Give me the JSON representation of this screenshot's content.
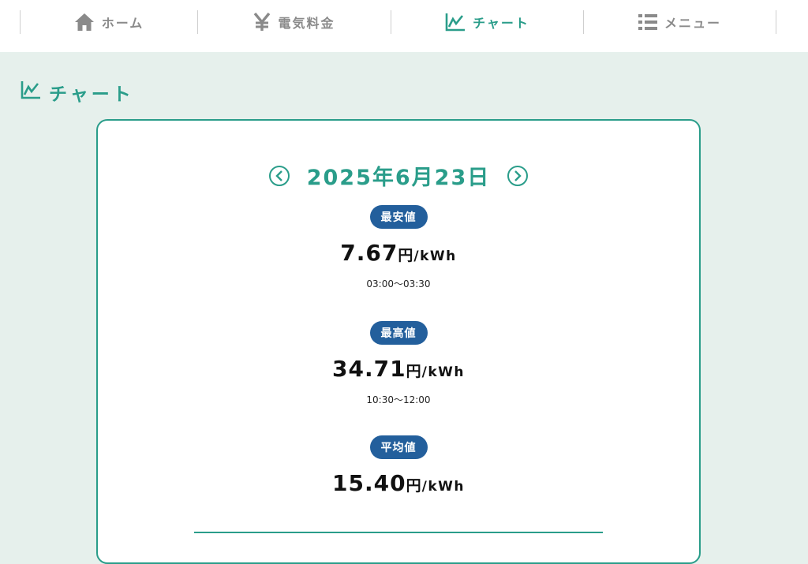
{
  "nav": {
    "items": [
      {
        "label": "ホーム",
        "icon": "home-icon"
      },
      {
        "label": "電気料金",
        "icon": "yen-icon"
      },
      {
        "label": "チャート",
        "icon": "chart-icon",
        "active": true
      },
      {
        "label": "メニュー",
        "icon": "list-icon"
      }
    ]
  },
  "page": {
    "title": "チャート"
  },
  "card": {
    "date": "2025年6月23日",
    "stats": [
      {
        "badge": "最安値",
        "value": "7.67",
        "unit": "円",
        "per": "/kWh",
        "time": "03:00〜03:30"
      },
      {
        "badge": "最高値",
        "value": "34.71",
        "unit": "円",
        "per": "/kWh",
        "time": "10:30〜12:00"
      },
      {
        "badge": "平均値",
        "value": "15.40",
        "unit": "円",
        "per": "/kWh",
        "time": ""
      }
    ]
  },
  "colors": {
    "accent": "#2a9d8a",
    "badge": "#235f9c",
    "background": "#e6f0ec",
    "nav_inactive": "#8a8a8a"
  }
}
